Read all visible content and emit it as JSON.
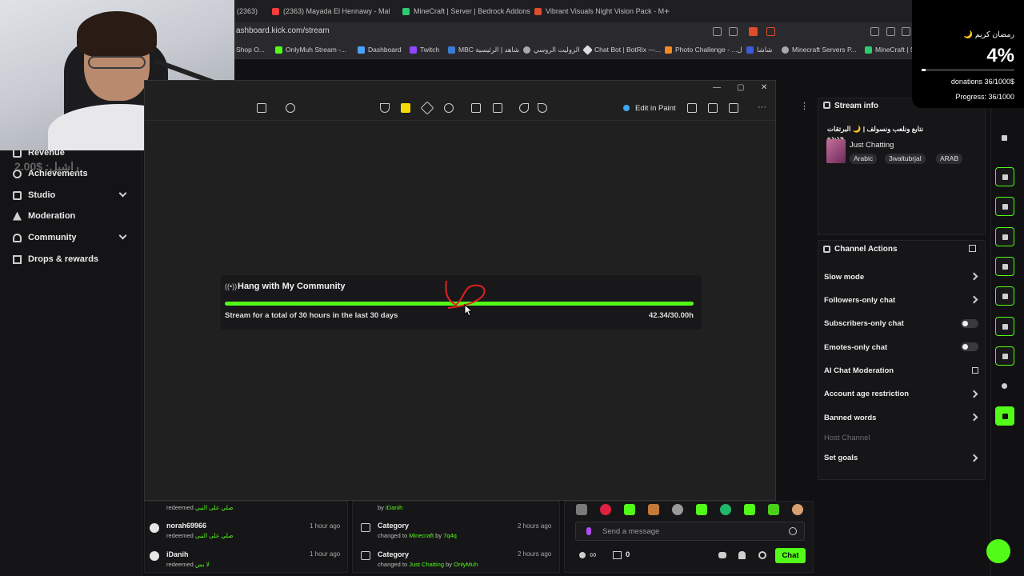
{
  "browser": {
    "tabs": [
      {
        "label": "(2363)",
        "color": "#9a9a9a"
      },
      {
        "label": "(2363) Mayada El Hennawy - Mal",
        "color": "#ff3b3b"
      },
      {
        "label": "MineCraft | Server | Bedrock Addons",
        "color": "#2ecc71"
      },
      {
        "label": "Vibrant Visuals Night Vision Pack - M",
        "color": "#e04b2a"
      }
    ],
    "new_tab": "+",
    "url": "ashboard.kick.com/stream",
    "bookmarks": [
      {
        "label": "Shop O...",
        "color": "#999"
      },
      {
        "label": "OnlyMuh Stream -...",
        "color": "#53fc18"
      },
      {
        "label": "Dashboard",
        "color": "#4ca3ff"
      },
      {
        "label": "Twitch",
        "color": "#9146ff"
      },
      {
        "label": "MBC شاهد | الرئيسية",
        "color": "#3a7bd5"
      },
      {
        "label": "الزوليت الروسي",
        "color": "#aaa"
      },
      {
        "label": "Chat Bot | BotRix —...",
        "color": "#ddd"
      },
      {
        "label": "Photo Challenge - ...ل",
        "color": "#f08a24"
      },
      {
        "label": "شاشا",
        "color": "#3b5bdb"
      },
      {
        "label": "Minecraft Servers P...",
        "color": "#aaa"
      },
      {
        "label": "MineCraft | S",
        "color": "#2ecc71"
      }
    ]
  },
  "webcam": {
    "overlay_text": "2.00$ :راشيل"
  },
  "leftnav": {
    "items": [
      {
        "label": "Revenue"
      },
      {
        "label": "Achievements"
      },
      {
        "label": "Studio"
      },
      {
        "label": "Moderation"
      },
      {
        "label": "Community"
      },
      {
        "label": "Drops & rewards"
      }
    ]
  },
  "snip": {
    "window_controls": [
      "—",
      "▢",
      "✕"
    ],
    "edit_in_paint": "Edit in Paint",
    "more": "···"
  },
  "goal": {
    "title": "Hang with My Community",
    "description": "Stream for a total of 30 hours in the last 30 days",
    "count": "42.34/30.00h",
    "progress": 1.0,
    "fill_color": "#53fc18"
  },
  "stream_info": {
    "title": "Stream info",
    "stream_title": "نتابع ونلعب ونسولف | 🌙 البرتقات جديده",
    "category": "Just Chatting",
    "tags": [
      "Arabic",
      "3waltubrjal",
      "ARAB"
    ]
  },
  "channel_actions": {
    "title": "Channel Actions",
    "items": [
      {
        "label": "Slow mode"
      },
      {
        "label": "Followers-only chat"
      },
      {
        "label": "Subscribers-only chat"
      },
      {
        "label": "Emotes-only chat"
      },
      {
        "label": "AI Chat Moderation"
      },
      {
        "label": "Account age restriction"
      },
      {
        "label": "Banned words"
      },
      {
        "label": "Host Channel"
      },
      {
        "label": "Set goals"
      }
    ]
  },
  "overlay": {
    "greeting": "رمضان كريم 🌙",
    "percent": "4%",
    "donations": "donations 36/1000$",
    "progress": "Progress: 36/1000"
  },
  "redeems": [
    {
      "user": "",
      "action": "redeemed",
      "reward": "صلي على النبي",
      "time": ""
    },
    {
      "user": "norah69966",
      "action": "redeemed",
      "reward": "صلي على النبي",
      "time": "1 hour ago"
    },
    {
      "user": "iDanih",
      "action": "redeemed",
      "reward": "لا بس",
      "time": "1 hour ago"
    }
  ],
  "activity": [
    {
      "title": "",
      "line": "by",
      "who": "iDanih",
      "time": ""
    },
    {
      "title": "Category",
      "line": "changed to",
      "what": "Minecraft",
      "by": "by",
      "who": "7q4q",
      "time": "2 hours ago"
    },
    {
      "title": "Category",
      "line": "changed to",
      "what": "Just Chatting",
      "by": "by",
      "who": "OnlyMuh",
      "time": "2 hours ago"
    }
  ],
  "chat": {
    "placeholder": "Send a message",
    "viewers_icon": "∞",
    "count": "0",
    "send": "Chat"
  }
}
